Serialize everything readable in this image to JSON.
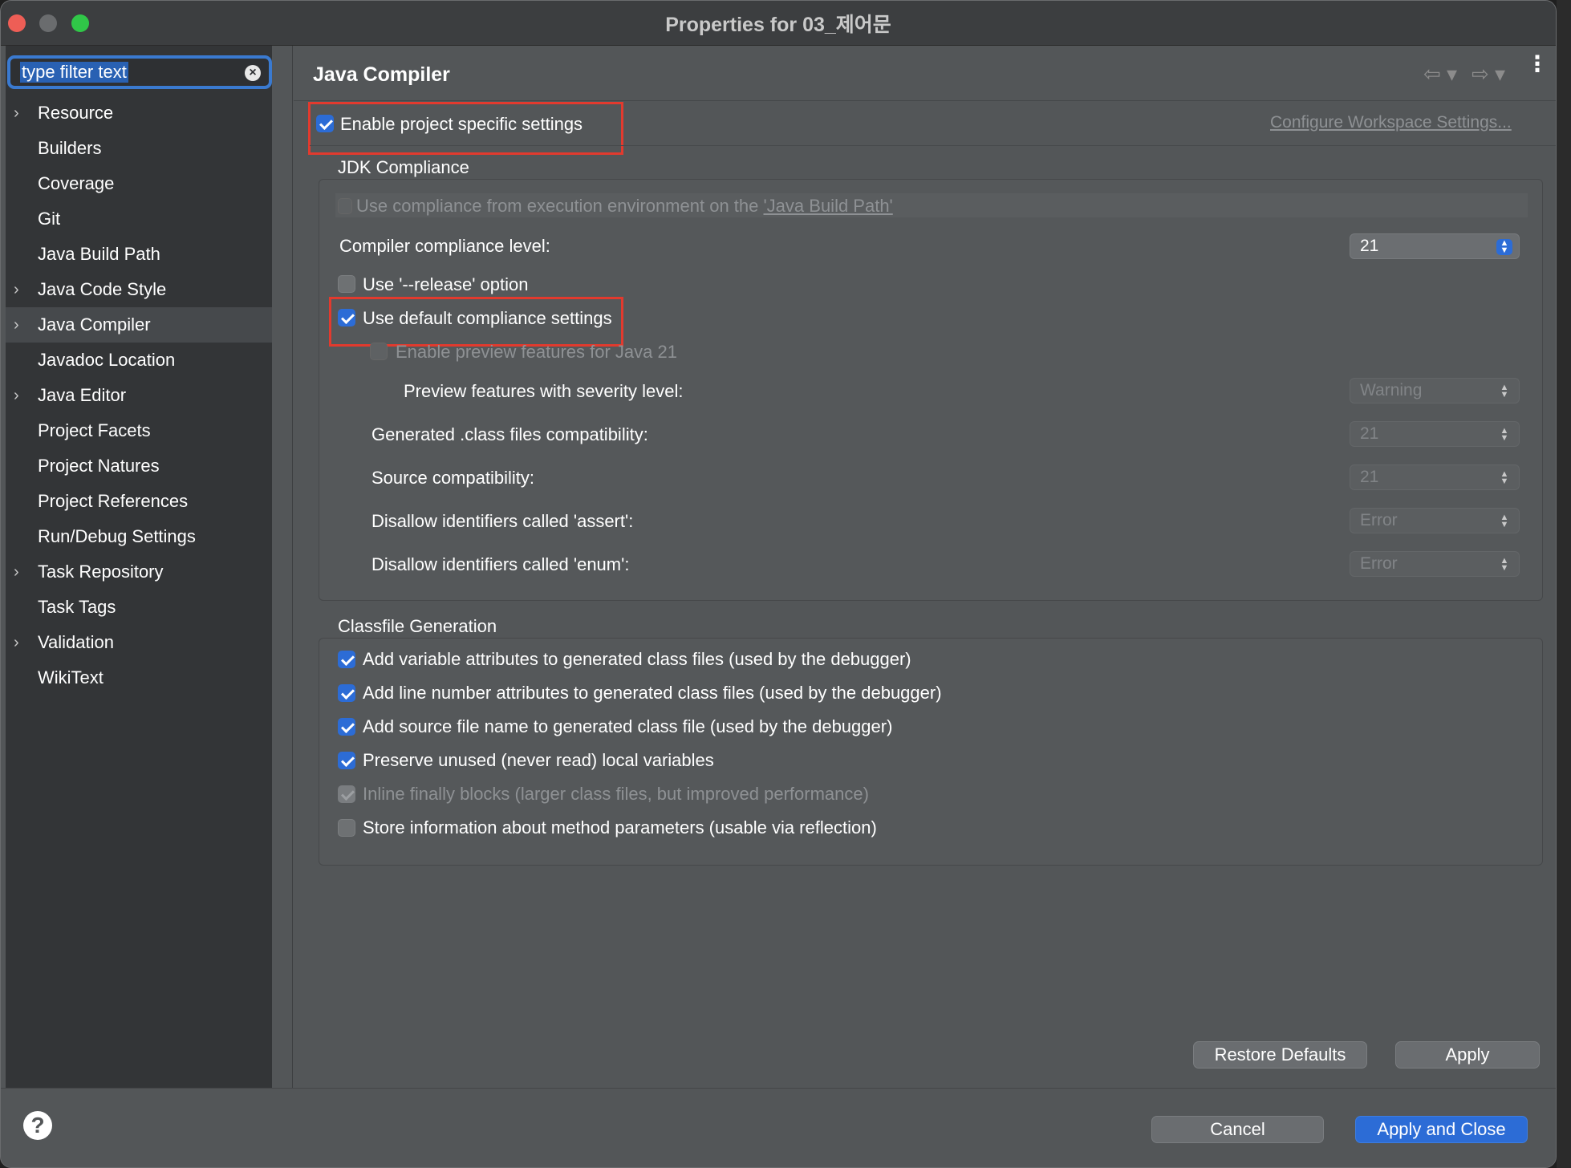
{
  "window": {
    "title": "Properties for 03_제어문"
  },
  "filter": {
    "placeholder": "type filter text",
    "clear_icon": "×"
  },
  "tree": [
    {
      "label": "Resource",
      "expandable": true
    },
    {
      "label": "Builders",
      "expandable": false
    },
    {
      "label": "Coverage",
      "expandable": false
    },
    {
      "label": "Git",
      "expandable": false
    },
    {
      "label": "Java Build Path",
      "expandable": false
    },
    {
      "label": "Java Code Style",
      "expandable": true
    },
    {
      "label": "Java Compiler",
      "expandable": true,
      "selected": true
    },
    {
      "label": "Javadoc Location",
      "expandable": false
    },
    {
      "label": "Java Editor",
      "expandable": true
    },
    {
      "label": "Project Facets",
      "expandable": false
    },
    {
      "label": "Project Natures",
      "expandable": false
    },
    {
      "label": "Project References",
      "expandable": false
    },
    {
      "label": "Run/Debug Settings",
      "expandable": false
    },
    {
      "label": "Task Repository",
      "expandable": true
    },
    {
      "label": "Task Tags",
      "expandable": false
    },
    {
      "label": "Validation",
      "expandable": true
    },
    {
      "label": "WikiText",
      "expandable": false
    }
  ],
  "page": {
    "title": "Java Compiler",
    "enable_project_specific": "Enable project specific settings",
    "configure_workspace": "Configure Workspace Settings..."
  },
  "jdk": {
    "group_title": "JDK Compliance",
    "use_ee_prefix": "Use compliance from execution environment on the ",
    "use_ee_link": "'Java Build Path'",
    "compliance_level_label": "Compiler compliance level:",
    "compliance_level_value": "21",
    "release_option": "Use '--release' option",
    "default_compliance": "Use default compliance settings",
    "enable_preview": "Enable preview features for Java 21",
    "preview_severity_label": "Preview features with severity level:",
    "preview_severity_value": "Warning",
    "generated_label": "Generated .class files compatibility:",
    "generated_value": "21",
    "source_label": "Source compatibility:",
    "source_value": "21",
    "assert_label": "Disallow identifiers called 'assert':",
    "assert_value": "Error",
    "enum_label": "Disallow identifiers called 'enum':",
    "enum_value": "Error"
  },
  "classfile": {
    "group_title": "Classfile Generation",
    "options": [
      {
        "label": "Add variable attributes to generated class files (used by the debugger)",
        "checked": true,
        "disabled": false
      },
      {
        "label": "Add line number attributes to generated class files (used by the debugger)",
        "checked": true,
        "disabled": false
      },
      {
        "label": "Add source file name to generated class file (used by the debugger)",
        "checked": true,
        "disabled": false
      },
      {
        "label": "Preserve unused (never read) local variables",
        "checked": true,
        "disabled": false
      },
      {
        "label": "Inline finally blocks (larger class files, but improved performance)",
        "checked": true,
        "disabled": true
      },
      {
        "label": "Store information about method parameters (usable via reflection)",
        "checked": false,
        "disabled": false
      }
    ]
  },
  "buttons": {
    "restore_defaults": "Restore Defaults",
    "apply": "Apply",
    "cancel": "Cancel",
    "apply_and_close": "Apply and Close",
    "help": "?"
  },
  "icons": {
    "tree_arrow": "›",
    "nav_back": "⇦ ▾",
    "nav_forward": "⇨ ▾",
    "menu_dots": "⋮",
    "combo_arrows": "▲▼"
  },
  "colors": {
    "accent": "#2c6cd6",
    "highlight_box": "#e23a2e",
    "panel_bg": "#535658",
    "sidebar_bg": "#333537"
  }
}
